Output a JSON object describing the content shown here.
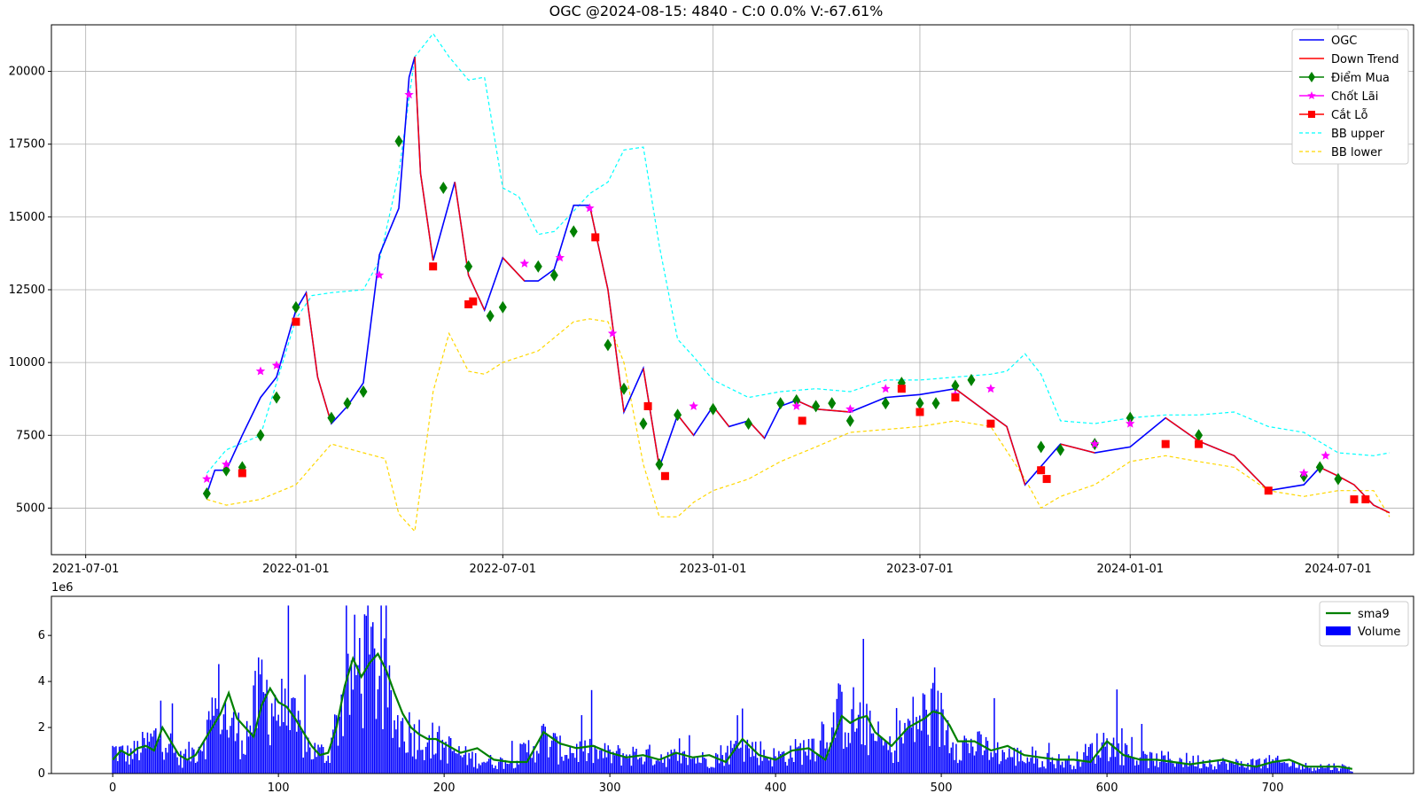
{
  "chart_data": [
    {
      "type": "line",
      "title": "OGC @2024-08-15: 4840 - C:0 0.0% V:-67.61%",
      "xlabel": "",
      "ylabel": "",
      "x_ticks": [
        "2021-07-01",
        "2022-01-01",
        "2022-07-01",
        "2023-01-01",
        "2023-07-01",
        "2024-01-01",
        "2024-07-01"
      ],
      "y_ticks": [
        "5000",
        "7500",
        "10000",
        "12500",
        "15000",
        "17500",
        "20000"
      ],
      "xlim": [
        "2021-06-01",
        "2024-09-05"
      ],
      "ylim": [
        3400,
        21600
      ],
      "grid": true,
      "legend_position": "top-right",
      "colors": {
        "price": "#0000ff",
        "down": "#ff0000",
        "buy": "#008000",
        "take_profit": "#ff00ff",
        "stop_loss": "#ff0000",
        "bb_upper": "#00ffff",
        "bb_lower": "#ffd700"
      },
      "legend": [
        "OGC",
        "Down Trend",
        "Điểm Mua",
        "Chốt Lãi",
        "Cắt Lỗ",
        "BB upper",
        "BB lower"
      ],
      "series": [
        {
          "name": "OGC",
          "x": [
            "2021-10-15",
            "2021-10-22",
            "2021-11-01",
            "2021-11-15",
            "2021-12-01",
            "2021-12-15",
            "2022-01-01",
            "2022-01-10",
            "2022-01-20",
            "2022-02-01",
            "2022-02-15",
            "2022-03-01",
            "2022-03-15",
            "2022-04-01",
            "2022-04-10",
            "2022-04-15",
            "2022-04-20",
            "2022-05-01",
            "2022-05-20",
            "2022-06-01",
            "2022-06-15",
            "2022-07-01",
            "2022-07-20",
            "2022-08-01",
            "2022-08-15",
            "2022-09-01",
            "2022-09-15",
            "2022-10-01",
            "2022-10-15",
            "2022-11-01",
            "2022-11-15",
            "2022-12-01",
            "2022-12-15",
            "2023-01-01",
            "2023-01-15",
            "2023-02-01",
            "2023-02-15",
            "2023-03-01",
            "2023-03-15",
            "2023-04-01",
            "2023-05-01",
            "2023-06-01",
            "2023-07-01",
            "2023-08-01",
            "2023-09-01",
            "2023-09-15",
            "2023-10-01",
            "2023-11-01",
            "2023-12-01",
            "2024-01-01",
            "2024-02-01",
            "2024-03-01",
            "2024-04-01",
            "2024-05-01",
            "2024-06-01",
            "2024-06-15",
            "2024-07-01",
            "2024-07-15",
            "2024-08-01",
            "2024-08-15"
          ],
          "values": [
            5500,
            6300,
            6300,
            7500,
            8800,
            9500,
            11800,
            12400,
            9500,
            7900,
            8500,
            9300,
            13700,
            15300,
            19800,
            20500,
            16500,
            13500,
            16200,
            13000,
            11800,
            13600,
            12800,
            12800,
            13200,
            15400,
            15400,
            12500,
            8300,
            9800,
            6400,
            8200,
            7500,
            8500,
            7800,
            8000,
            7400,
            8500,
            8700,
            8400,
            8300,
            8800,
            8900,
            9100,
            8200,
            7800,
            5800,
            7200,
            6900,
            7100,
            8100,
            7300,
            6800,
            5600,
            5800,
            6400,
            6100,
            5800,
            5100,
            4840
          ]
        },
        {
          "name": "BB upper",
          "x": [
            "2021-10-15",
            "2021-11-01",
            "2021-12-01",
            "2022-01-01",
            "2022-01-15",
            "2022-02-01",
            "2022-03-01",
            "2022-03-15",
            "2022-04-01",
            "2022-04-15",
            "2022-05-01",
            "2022-05-15",
            "2022-06-01",
            "2022-06-15",
            "2022-07-01",
            "2022-07-15",
            "2022-08-01",
            "2022-08-15",
            "2022-09-01",
            "2022-09-15",
            "2022-10-01",
            "2022-10-15",
            "2022-11-01",
            "2022-11-15",
            "2022-12-01",
            "2022-12-15",
            "2023-01-01",
            "2023-02-01",
            "2023-03-01",
            "2023-04-01",
            "2023-05-01",
            "2023-06-01",
            "2023-07-01",
            "2023-08-01",
            "2023-09-01",
            "2023-09-15",
            "2023-10-01",
            "2023-10-15",
            "2023-11-01",
            "2023-12-01",
            "2024-01-01",
            "2024-02-01",
            "2024-03-01",
            "2024-04-01",
            "2024-05-01",
            "2024-06-01",
            "2024-07-01",
            "2024-08-01",
            "2024-08-15"
          ],
          "values": [
            6200,
            7000,
            7500,
            11500,
            12300,
            12400,
            12500,
            13500,
            16500,
            20500,
            21300,
            20500,
            19700,
            19800,
            16000,
            15700,
            14400,
            14500,
            15200,
            15800,
            16200,
            17300,
            17400,
            14000,
            10800,
            10200,
            9400,
            8800,
            9000,
            9100,
            9000,
            9400,
            9400,
            9500,
            9600,
            9700,
            10300,
            9600,
            8000,
            7900,
            8100,
            8200,
            8200,
            8300,
            7800,
            7600,
            6900,
            6800,
            6900
          ]
        },
        {
          "name": "BB lower",
          "x": [
            "2021-10-15",
            "2021-11-01",
            "2021-12-01",
            "2022-01-01",
            "2022-02-01",
            "2022-03-01",
            "2022-03-20",
            "2022-04-01",
            "2022-04-15",
            "2022-05-01",
            "2022-05-15",
            "2022-06-01",
            "2022-06-15",
            "2022-07-01",
            "2022-08-01",
            "2022-09-01",
            "2022-09-15",
            "2022-10-01",
            "2022-10-15",
            "2022-11-01",
            "2022-11-15",
            "2022-12-01",
            "2022-12-15",
            "2023-01-01",
            "2023-02-01",
            "2023-03-01",
            "2023-04-01",
            "2023-05-01",
            "2023-06-01",
            "2023-07-01",
            "2023-08-01",
            "2023-09-01",
            "2023-10-01",
            "2023-10-15",
            "2023-11-01",
            "2023-12-01",
            "2024-01-01",
            "2024-02-01",
            "2024-03-01",
            "2024-04-01",
            "2024-05-01",
            "2024-06-01",
            "2024-07-01",
            "2024-08-01",
            "2024-08-15"
          ],
          "values": [
            5300,
            5100,
            5300,
            5800,
            7200,
            6900,
            6700,
            4800,
            4200,
            9000,
            11000,
            9700,
            9600,
            10000,
            10400,
            11400,
            11500,
            11400,
            10000,
            6500,
            4700,
            4700,
            5200,
            5600,
            6000,
            6600,
            7100,
            7600,
            7700,
            7800,
            8000,
            7800,
            6000,
            5000,
            5400,
            5800,
            6600,
            6800,
            6600,
            6400,
            5600,
            5400,
            5600,
            5600,
            4700
          ]
        }
      ],
      "buy_points": {
        "name": "Điểm Mua",
        "x": [
          "2021-10-15",
          "2021-11-01",
          "2021-11-15",
          "2021-12-01",
          "2021-12-15",
          "2022-01-01",
          "2022-02-01",
          "2022-02-15",
          "2022-03-01",
          "2022-04-01",
          "2022-05-10",
          "2022-06-01",
          "2022-06-20",
          "2022-07-01",
          "2022-08-01",
          "2022-08-15",
          "2022-09-01",
          "2022-10-01",
          "2022-10-15",
          "2022-11-01",
          "2022-11-15",
          "2022-12-01",
          "2023-01-01",
          "2023-02-01",
          "2023-03-01",
          "2023-03-15",
          "2023-04-01",
          "2023-04-15",
          "2023-05-01",
          "2023-06-01",
          "2023-06-15",
          "2023-07-01",
          "2023-07-15",
          "2023-08-01",
          "2023-08-15",
          "2023-10-15",
          "2023-11-01",
          "2023-12-01",
          "2024-01-01",
          "2024-03-01",
          "2024-06-01",
          "2024-06-15",
          "2024-07-01"
        ],
        "values": [
          5500,
          6300,
          6400,
          7500,
          8800,
          11900,
          8100,
          8600,
          9000,
          17600,
          16000,
          13300,
          11600,
          11900,
          13300,
          13000,
          14500,
          10600,
          9100,
          7900,
          6500,
          8200,
          8400,
          7900,
          8600,
          8700,
          8500,
          8600,
          8000,
          8600,
          9300,
          8600,
          8600,
          9200,
          9400,
          7100,
          7000,
          7200,
          8100,
          7500,
          6100,
          6400,
          6000
        ]
      },
      "take_profit_points": {
        "name": "Chốt Lãi",
        "x": [
          "2021-10-15",
          "2021-11-01",
          "2021-12-01",
          "2021-12-15",
          "2022-03-15",
          "2022-04-10",
          "2022-07-20",
          "2022-08-20",
          "2022-09-15",
          "2022-10-05",
          "2022-12-15",
          "2023-03-15",
          "2023-05-01",
          "2023-06-01",
          "2023-08-01",
          "2023-09-01",
          "2023-12-01",
          "2024-01-01",
          "2024-06-01",
          "2024-06-20"
        ],
        "values": [
          6000,
          6500,
          9700,
          9900,
          13000,
          19200,
          13400,
          13600,
          15300,
          11000,
          8500,
          8500,
          8400,
          9100,
          8900,
          9100,
          7200,
          7900,
          6200,
          6800
        ]
      },
      "stop_loss_points": {
        "name": "Cắt Lỗ",
        "x": [
          "2021-11-15",
          "2022-01-01",
          "2022-05-01",
          "2022-06-01",
          "2022-06-05",
          "2022-09-20",
          "2022-11-05",
          "2022-11-20",
          "2023-03-20",
          "2023-06-15",
          "2023-07-01",
          "2023-08-01",
          "2023-09-01",
          "2023-10-15",
          "2023-10-20",
          "2024-02-01",
          "2024-03-01",
          "2024-05-01",
          "2024-07-15",
          "2024-07-25"
        ],
        "values": [
          6200,
          11400,
          13300,
          12000,
          12100,
          14300,
          8500,
          6100,
          8000,
          9100,
          8300,
          8800,
          7900,
          6300,
          6000,
          7200,
          7200,
          5600,
          5300,
          5300
        ]
      }
    },
    {
      "type": "bar",
      "title": "",
      "xlabel": "",
      "ylabel": "",
      "y_scale_label": "1e6",
      "x_ticks": [
        "0",
        "100",
        "200",
        "300",
        "400",
        "500",
        "600",
        "700"
      ],
      "y_ticks": [
        "0",
        "2",
        "4",
        "6"
      ],
      "xlim": [
        -37,
        785
      ],
      "ylim": [
        0,
        7.7
      ],
      "legend_position": "top-right",
      "legend": [
        "sma9",
        "Volume"
      ],
      "colors": {
        "volume": "#0000ff",
        "sma9": "#008000"
      },
      "volume_profile": {
        "x": [
          0,
          10,
          20,
          30,
          40,
          50,
          60,
          65,
          70,
          80,
          90,
          100,
          110,
          120,
          130,
          140,
          150,
          160,
          170,
          180,
          190,
          200,
          210,
          220,
          230,
          240,
          260,
          270,
          280,
          300,
          320,
          340,
          360,
          380,
          400,
          420,
          440,
          450,
          460,
          470,
          480,
          490,
          500,
          510,
          520,
          540,
          560,
          580,
          600,
          610,
          620,
          640,
          660,
          680,
          700,
          720,
          740,
          748
        ],
        "values": [
          1.0,
          0.8,
          1.2,
          1.8,
          0.6,
          1.0,
          2.2,
          3.3,
          2.0,
          1.6,
          3.5,
          2.8,
          2.0,
          1.0,
          0.8,
          3.5,
          4.8,
          4.5,
          2.2,
          1.8,
          1.5,
          1.2,
          0.8,
          0.6,
          0.5,
          0.5,
          1.5,
          1.0,
          1.0,
          0.8,
          0.8,
          0.7,
          0.6,
          1.2,
          0.7,
          1.1,
          2.6,
          2.3,
          1.5,
          1.0,
          2.0,
          2.5,
          2.3,
          1.3,
          1.2,
          0.8,
          0.6,
          0.5,
          1.4,
          0.9,
          0.6,
          0.6,
          0.5,
          0.4,
          0.5,
          0.3,
          0.3,
          0.2
        ]
      },
      "series": [
        {
          "name": "sma9",
          "x": [
            0,
            5,
            10,
            15,
            20,
            25,
            30,
            35,
            40,
            45,
            50,
            55,
            60,
            65,
            70,
            75,
            80,
            85,
            90,
            95,
            100,
            105,
            110,
            115,
            120,
            125,
            130,
            135,
            140,
            145,
            150,
            155,
            160,
            165,
            170,
            175,
            180,
            185,
            190,
            195,
            200,
            210,
            220,
            230,
            240,
            250,
            260,
            270,
            280,
            290,
            300,
            310,
            320,
            330,
            340,
            350,
            360,
            370,
            380,
            390,
            400,
            410,
            420,
            430,
            440,
            445,
            450,
            455,
            460,
            470,
            480,
            490,
            495,
            500,
            505,
            510,
            520,
            530,
            540,
            550,
            560,
            570,
            580,
            590,
            600,
            605,
            610,
            620,
            630,
            640,
            650,
            660,
            670,
            680,
            690,
            700,
            710,
            720,
            730,
            740,
            748
          ],
          "values": [
            0.6,
            1.0,
            0.8,
            1.1,
            1.2,
            1.0,
            2.0,
            1.4,
            0.8,
            0.6,
            0.8,
            1.4,
            2.0,
            2.6,
            3.5,
            2.4,
            2.0,
            1.6,
            3.0,
            3.7,
            3.1,
            2.9,
            2.4,
            1.8,
            1.2,
            0.8,
            0.9,
            2.0,
            3.8,
            5.0,
            4.2,
            4.8,
            5.2,
            4.5,
            3.5,
            2.6,
            2.0,
            1.7,
            1.5,
            1.5,
            1.3,
            0.9,
            1.1,
            0.6,
            0.5,
            0.5,
            1.8,
            1.3,
            1.1,
            1.2,
            0.9,
            0.7,
            0.8,
            0.6,
            0.9,
            0.7,
            0.8,
            0.5,
            1.5,
            0.8,
            0.6,
            1.0,
            1.1,
            0.6,
            2.5,
            2.2,
            2.4,
            2.5,
            1.8,
            1.2,
            2.0,
            2.4,
            2.7,
            2.6,
            2.1,
            1.4,
            1.4,
            1.0,
            1.2,
            0.8,
            0.7,
            0.6,
            0.6,
            0.5,
            1.4,
            1.1,
            0.8,
            0.6,
            0.6,
            0.5,
            0.4,
            0.5,
            0.6,
            0.4,
            0.3,
            0.5,
            0.6,
            0.3,
            0.3,
            0.3,
            0.2
          ]
        },
        {
          "name": "Volume",
          "source": "volume_profile",
          "count": 749
        }
      ]
    }
  ]
}
